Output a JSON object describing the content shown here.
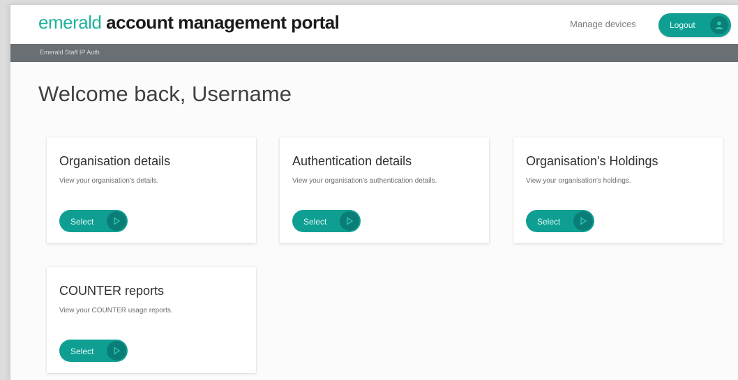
{
  "header": {
    "brand_light": "emerald",
    "brand_bold": "account management portal",
    "manage_devices": "Manage devices",
    "logout": "Logout"
  },
  "subbar": {
    "text": "Emerald Staff IP Auth"
  },
  "welcome": "Welcome back, Username",
  "cards": [
    {
      "title": "Organisation details",
      "desc": "View your organisation's details.",
      "button": "Select"
    },
    {
      "title": "Authentication details",
      "desc": "View your organisation's authentication details.",
      "button": "Select"
    },
    {
      "title": "Organisation's Holdings",
      "desc": "View your organisation's holdings.",
      "button": "Select"
    },
    {
      "title": "COUNTER reports",
      "desc": "View your COUNTER usage reports.",
      "button": "Select"
    }
  ],
  "colors": {
    "accent": "#0e9f92",
    "brand_green": "#1fb39b",
    "subbar": "#6a6f74"
  }
}
